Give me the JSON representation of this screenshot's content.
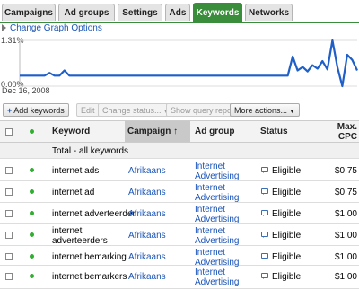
{
  "tabs": [
    {
      "label": "Campaigns"
    },
    {
      "label": "Ad groups"
    },
    {
      "label": "Settings"
    },
    {
      "label": "Ads"
    },
    {
      "label": "Keywords"
    },
    {
      "label": "Networks"
    }
  ],
  "graph": {
    "options_link": "Change Graph Options",
    "y_max_label": "1.31%",
    "y_min_label": "0.00%",
    "start_date": "Dec 16, 2008",
    "line_color": "#1f5fc8",
    "series_values": [
      0.3,
      0.3,
      0.3,
      0.3,
      0.3,
      0.3,
      0.38,
      0.3,
      0.3,
      0.45,
      0.3,
      0.3,
      0.3,
      0.3,
      0.3,
      0.3,
      0.3,
      0.3,
      0.3,
      0.3,
      0.3,
      0.3,
      0.3,
      0.3,
      0.3,
      0.3,
      0.3,
      0.3,
      0.3,
      0.3,
      0.3,
      0.3,
      0.3,
      0.3,
      0.3,
      0.3,
      0.3,
      0.3,
      0.3,
      0.3,
      0.3,
      0.3,
      0.3,
      0.3,
      0.3,
      0.3,
      0.3,
      0.3,
      0.3,
      0.3,
      0.3,
      0.3,
      0.3,
      0.3,
      0.3,
      0.85,
      0.45,
      0.55,
      0.42,
      0.6,
      0.5,
      0.72,
      0.48,
      1.31,
      0.55,
      0.0,
      0.9,
      0.75,
      0.45
    ]
  },
  "toolbar": {
    "add_keywords": "Add keywords",
    "edit": "Edit",
    "change_status": "Change status...",
    "show_query_report": "Show query report",
    "more_actions": "More actions..."
  },
  "table": {
    "headers": {
      "keyword": "Keyword",
      "campaign": "Campaign",
      "sort_indicator": "↑",
      "ad_group": "Ad group",
      "status": "Status",
      "max_cpc_1": "Max.",
      "max_cpc_2": "CPC"
    },
    "total_label": "Total - all keywords",
    "rows": [
      {
        "keyword_1": "internet ads",
        "keyword_2": "",
        "campaign": "Afrikaans",
        "ad_group_1": "Internet",
        "ad_group_2": "Advertising",
        "status": "Eligible",
        "max_cpc": "$0.75"
      },
      {
        "keyword_1": "internet ad",
        "keyword_2": "",
        "campaign": "Afrikaans",
        "ad_group_1": "Internet",
        "ad_group_2": "Advertising",
        "status": "Eligible",
        "max_cpc": "$0.75"
      },
      {
        "keyword_1": "internet adverteerder",
        "keyword_2": "",
        "campaign": "Afrikaans",
        "ad_group_1": "Internet",
        "ad_group_2": "Advertising",
        "status": "Eligible",
        "max_cpc": "$1.00"
      },
      {
        "keyword_1": "internet",
        "keyword_2": "adverteerders",
        "campaign": "Afrikaans",
        "ad_group_1": "Internet",
        "ad_group_2": "Advertising",
        "status": "Eligible",
        "max_cpc": "$1.00"
      },
      {
        "keyword_1": "internet bemarking",
        "keyword_2": "",
        "campaign": "Afrikaans",
        "ad_group_1": "Internet",
        "ad_group_2": "Advertising",
        "status": "Eligible",
        "max_cpc": "$1.00"
      },
      {
        "keyword_1": "internet bemarkers",
        "keyword_2": "",
        "campaign": "Afrikaans",
        "ad_group_1": "Internet",
        "ad_group_2": "Advertising",
        "status": "Eligible",
        "max_cpc": "$1.00"
      }
    ]
  }
}
